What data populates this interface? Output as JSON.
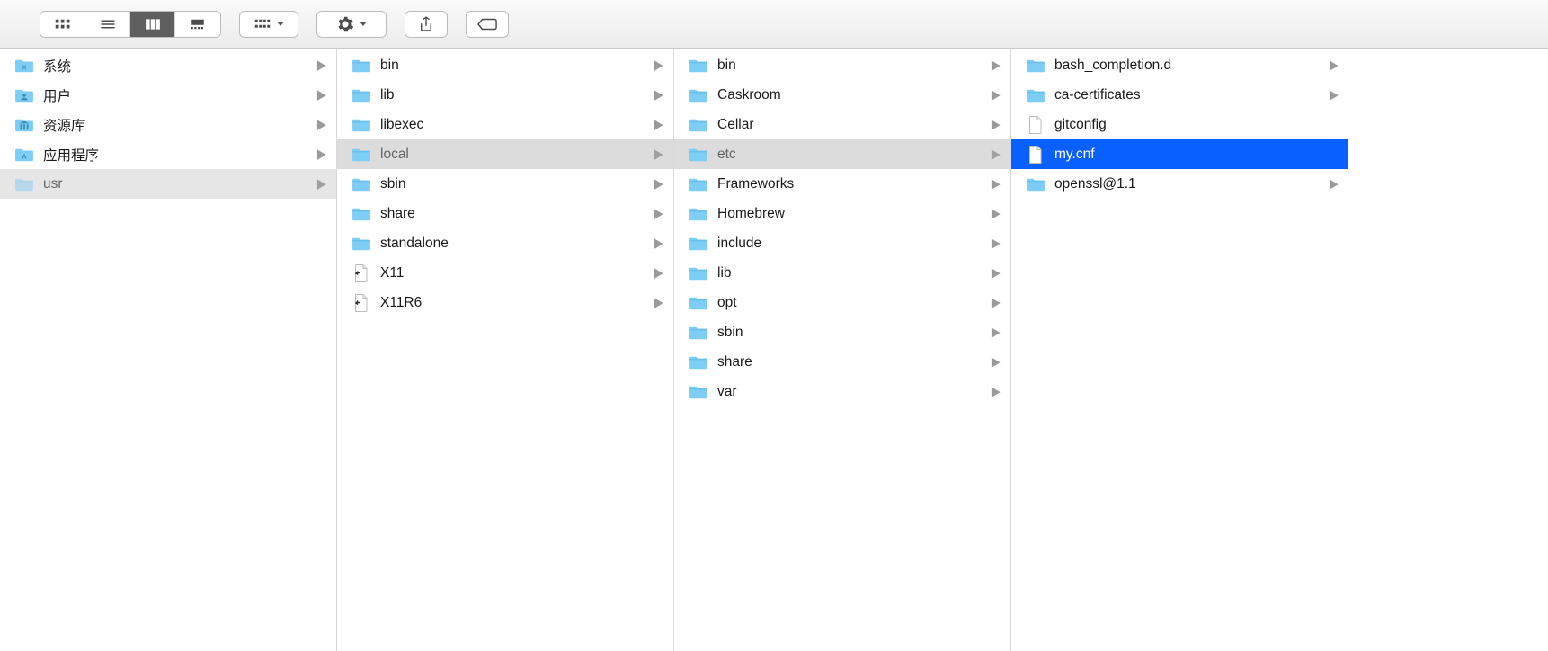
{
  "columns": [
    {
      "items": [
        {
          "name": "系统",
          "icon": "sys-x",
          "arrow": true
        },
        {
          "name": "用户",
          "icon": "sys-user",
          "arrow": true
        },
        {
          "name": "资源库",
          "icon": "sys-lib",
          "arrow": true
        },
        {
          "name": "应用程序",
          "icon": "sys-app",
          "arrow": true
        },
        {
          "name": "usr",
          "icon": "folder",
          "arrow": true,
          "path": true,
          "pathFolder": true
        }
      ]
    },
    {
      "items": [
        {
          "name": "bin",
          "icon": "folder",
          "arrow": true
        },
        {
          "name": "lib",
          "icon": "folder",
          "arrow": true
        },
        {
          "name": "libexec",
          "icon": "folder",
          "arrow": true
        },
        {
          "name": "local",
          "icon": "folder",
          "arrow": true,
          "path": true,
          "pathActive": true
        },
        {
          "name": "sbin",
          "icon": "folder",
          "arrow": true
        },
        {
          "name": "share",
          "icon": "folder",
          "arrow": true
        },
        {
          "name": "standalone",
          "icon": "folder",
          "arrow": true
        },
        {
          "name": "X11",
          "icon": "alias",
          "arrow": true
        },
        {
          "name": "X11R6",
          "icon": "alias",
          "arrow": true
        }
      ]
    },
    {
      "items": [
        {
          "name": "bin",
          "icon": "folder",
          "arrow": true
        },
        {
          "name": "Caskroom",
          "icon": "folder",
          "arrow": true
        },
        {
          "name": "Cellar",
          "icon": "folder",
          "arrow": true
        },
        {
          "name": "etc",
          "icon": "folder",
          "arrow": true,
          "path": true,
          "pathActive": true
        },
        {
          "name": "Frameworks",
          "icon": "folder",
          "arrow": true
        },
        {
          "name": "Homebrew",
          "icon": "folder",
          "arrow": true
        },
        {
          "name": "include",
          "icon": "folder",
          "arrow": true
        },
        {
          "name": "lib",
          "icon": "folder",
          "arrow": true
        },
        {
          "name": "opt",
          "icon": "folder",
          "arrow": true
        },
        {
          "name": "sbin",
          "icon": "folder",
          "arrow": true
        },
        {
          "name": "share",
          "icon": "folder",
          "arrow": true
        },
        {
          "name": "var",
          "icon": "folder",
          "arrow": true
        }
      ]
    },
    {
      "items": [
        {
          "name": "bash_completion.d",
          "icon": "folder",
          "arrow": true
        },
        {
          "name": "ca-certificates",
          "icon": "folder",
          "arrow": true
        },
        {
          "name": "gitconfig",
          "icon": "file",
          "arrow": false
        },
        {
          "name": "my.cnf",
          "icon": "file",
          "arrow": false,
          "selected": true
        },
        {
          "name": "openssl@1.1",
          "icon": "folder",
          "arrow": true
        }
      ]
    }
  ]
}
